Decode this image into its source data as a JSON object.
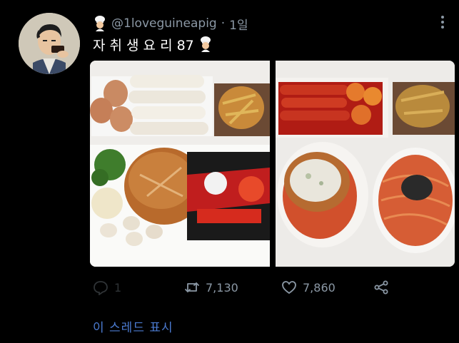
{
  "tweet": {
    "handle": "@1loveguineapig",
    "separator": "·",
    "time": "1일",
    "text": "자 취 생 요 리 87",
    "stats": {
      "replies": "1",
      "retweets": "7,130",
      "likes": "7,860"
    },
    "show_thread": "이 스레드 표시"
  },
  "icons": {
    "chef": "cook-emoji-icon",
    "more": "more-vertical-icon",
    "reply": "reply-icon",
    "retweet": "retweet-icon",
    "like": "heart-icon",
    "share": "share-icon"
  },
  "colors": {
    "background": "#000000",
    "text": "#e7e9ea",
    "muted": "#8b98a5",
    "link": "#4b7bd1"
  }
}
